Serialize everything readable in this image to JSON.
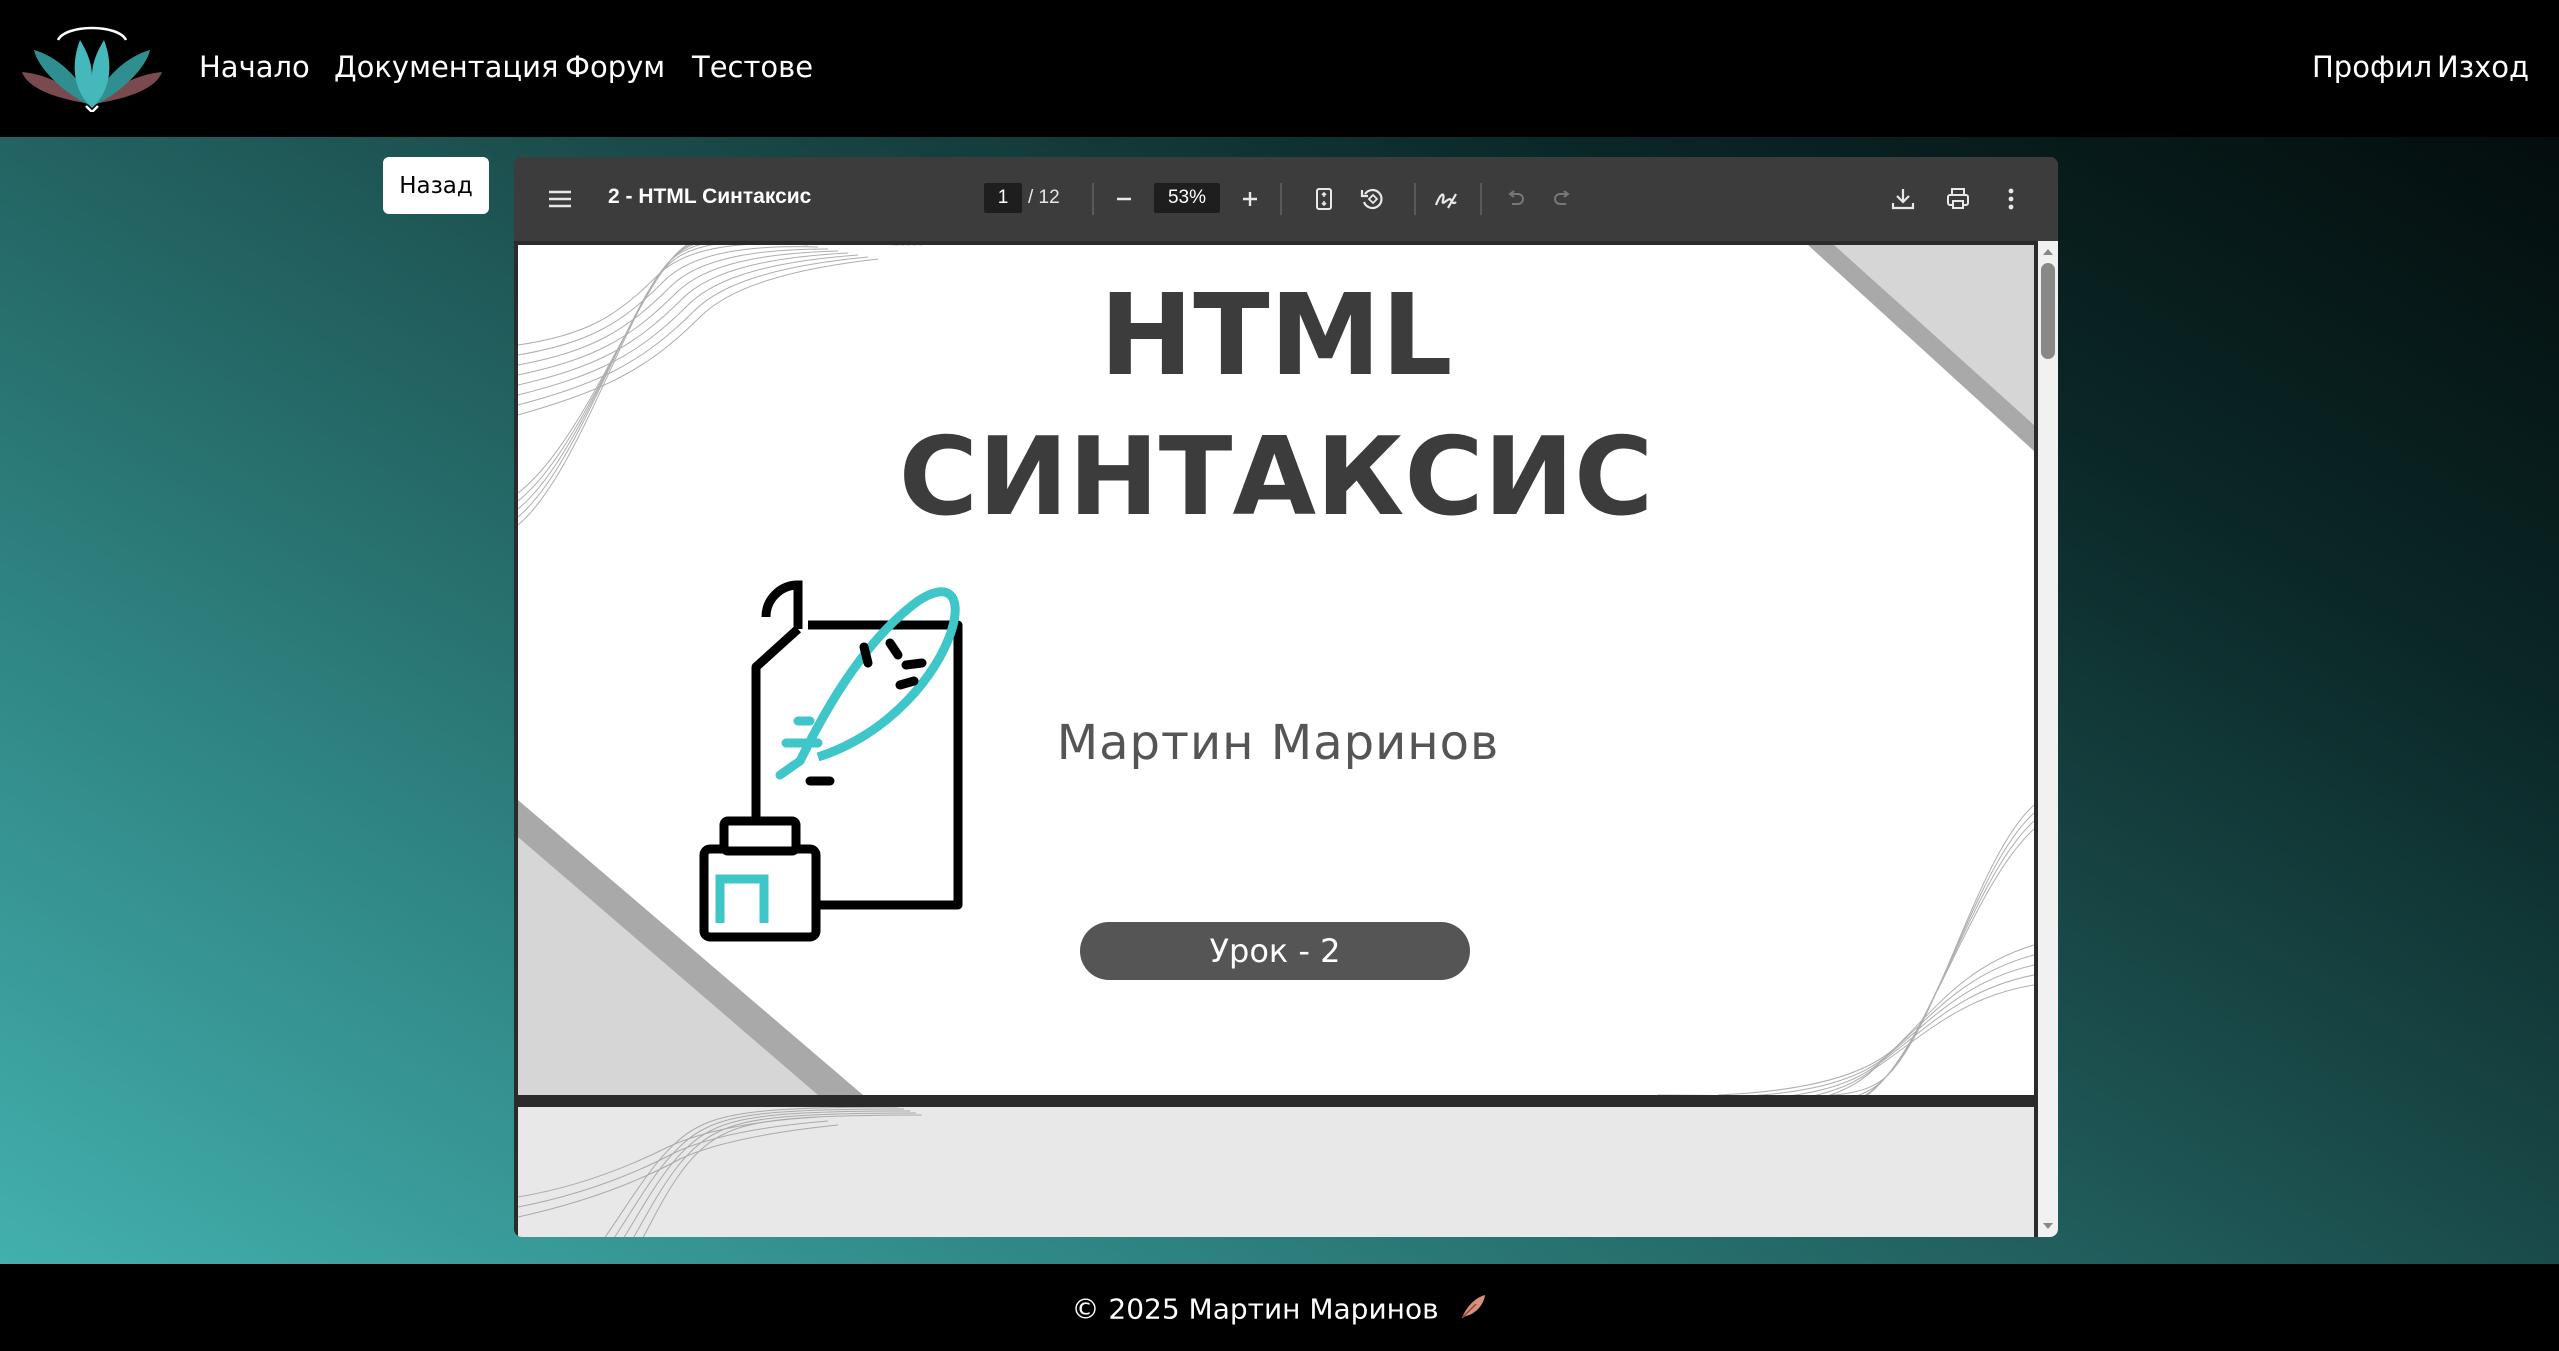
{
  "nav": {
    "links": [
      "Начало",
      "Документация",
      "Форум",
      "Тестове"
    ],
    "right_links": [
      "Профил",
      "Изход"
    ]
  },
  "back_button": "Назад",
  "viewer": {
    "title": "2 - HTML Синтаксис",
    "page_current": "1",
    "page_total": "/ 12",
    "zoom": "53%"
  },
  "slide": {
    "title_line1": "HTML",
    "title_line2": "СИНТАКСИС",
    "author": "Мартин Маринов",
    "lesson": "Урок - 2"
  },
  "footer": {
    "text": "© 2025 Мартин Маринов"
  },
  "colors": {
    "accent": "#3ec6c9",
    "toolbar": "#3c3c3c",
    "pill": "#555555"
  },
  "icons": [
    "lotus-logo",
    "menu-icon",
    "minus-icon",
    "plus-icon",
    "fit-page-icon",
    "rotate-icon",
    "annotate-icon",
    "undo-icon",
    "redo-icon",
    "download-icon",
    "print-icon",
    "more-icon",
    "quill-icon"
  ]
}
